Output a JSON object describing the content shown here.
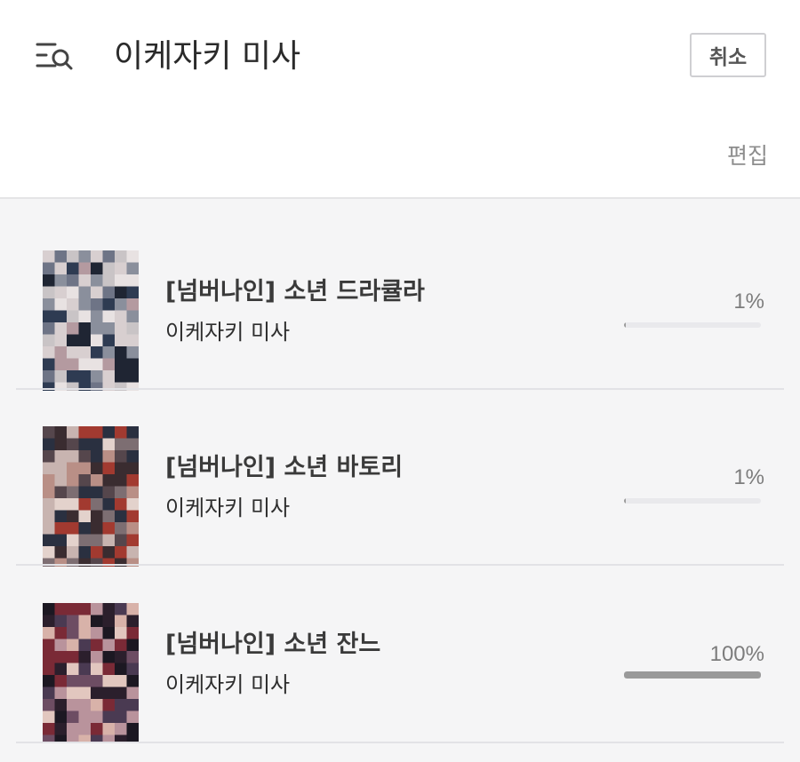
{
  "header": {
    "menu_icon": "menu-search-icon",
    "query": "이케자키 미사",
    "cancel_label": "취소",
    "edit_label": "편집"
  },
  "books": [
    {
      "title": "[넘버나인] 소년 드라큘라",
      "author": "이케자키 미사",
      "progress_label": "1%",
      "progress": 0.01,
      "cover_palette": [
        "#c9c4c6",
        "#8a8f9c",
        "#2e3b52",
        "#d8cfd0",
        "#6e7486",
        "#1f2533",
        "#b49aa0",
        "#e8e2e2"
      ]
    },
    {
      "title": "[넘버나인] 소년 바토리",
      "author": "이케자키 미사",
      "progress_label": "1%",
      "progress": 0.01,
      "cover_palette": [
        "#3a2c30",
        "#7d6e72",
        "#c8b4b0",
        "#a23a30",
        "#e3d2cc",
        "#55464c",
        "#2a3040",
        "#b98f86"
      ]
    },
    {
      "title": "[넘버나인] 소년 잔느",
      "author": "이케자키 미사",
      "progress_label": "100%",
      "progress": 1.0,
      "cover_palette": [
        "#2b1f2c",
        "#6d4d63",
        "#b9939c",
        "#e2c7bf",
        "#7a2a36",
        "#4a3a52",
        "#d8b2a9",
        "#1c1822"
      ]
    }
  ]
}
